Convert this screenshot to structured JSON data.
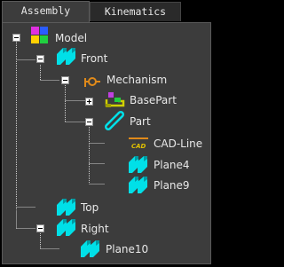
{
  "tabs": [
    {
      "label": "Assembly",
      "active": true
    },
    {
      "label": "Kinematics",
      "active": false
    }
  ],
  "tree": [
    {
      "label": "Model",
      "icon": "model-icon",
      "expander": "minus"
    },
    {
      "label": "Front",
      "icon": "plane-icon",
      "expander": "minus"
    },
    {
      "label": "Mechanism",
      "icon": "mechanism-icon",
      "expander": "minus"
    },
    {
      "label": "BasePart",
      "icon": "basepart-icon",
      "expander": "plus"
    },
    {
      "label": "Part",
      "icon": "part-link-icon",
      "expander": "minus"
    },
    {
      "label": "CAD-Line",
      "icon": "cad-icon",
      "expander": "none"
    },
    {
      "label": "Plane4",
      "icon": "plane-icon",
      "expander": "none"
    },
    {
      "label": "Plane9",
      "icon": "plane-icon",
      "expander": "none"
    },
    {
      "label": "Top",
      "icon": "plane-icon",
      "expander": "none"
    },
    {
      "label": "Right",
      "icon": "plane-icon",
      "expander": "minus"
    },
    {
      "label": "Plane10",
      "icon": "plane-icon",
      "expander": "none"
    }
  ],
  "cad_badge_text": "CAD",
  "colors": {
    "background": "#3c3c3c",
    "text": "#e8e8e8",
    "plane_cyan": "#00e0e8",
    "plane_cyan_dark": "#008f96",
    "connector_line": "#cfcfcf",
    "mechanism_orange": "#e08a1a",
    "cad_yellow": "#e0c000"
  }
}
